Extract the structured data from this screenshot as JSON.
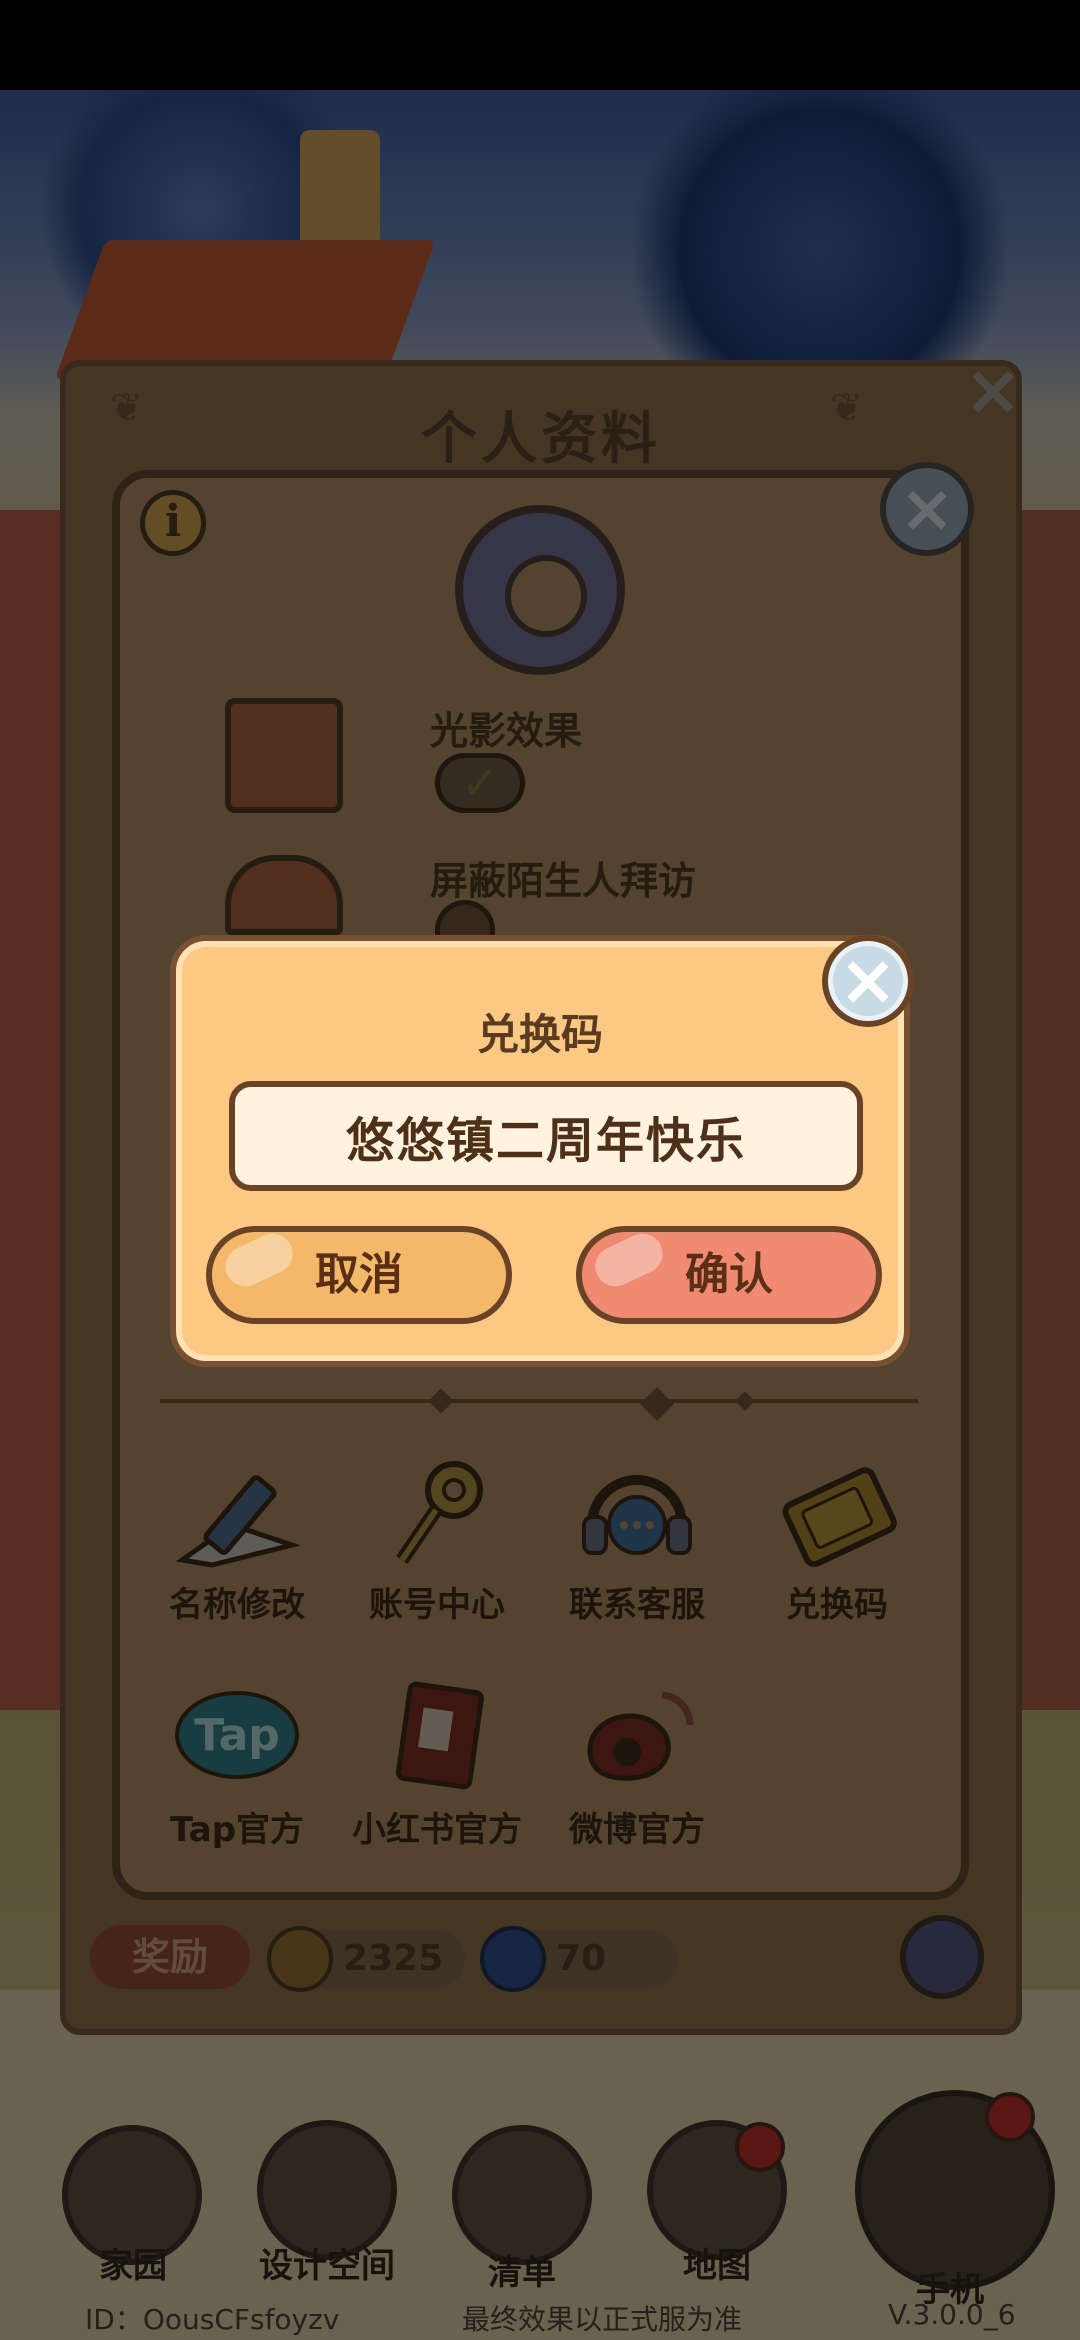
{
  "profile": {
    "title": "个人资料",
    "reward_label": "奖励",
    "coins": "2325",
    "gems": "70"
  },
  "settings": {
    "options": [
      {
        "label": "光影效果",
        "enabled": true
      },
      {
        "label": "屏蔽陌生人拜访",
        "enabled": false
      }
    ],
    "menu": [
      {
        "label": "名称修改",
        "icon": "pencil-icon"
      },
      {
        "label": "账号中心",
        "icon": "key-icon"
      },
      {
        "label": "联系客服",
        "icon": "headset-icon"
      },
      {
        "label": "兑换码",
        "icon": "ticket-icon"
      },
      {
        "label": "Tap官方",
        "icon": "tap-logo-icon"
      },
      {
        "label": "小红书官方",
        "icon": "red-book-icon"
      },
      {
        "label": "微博官方",
        "icon": "weibo-icon"
      }
    ]
  },
  "redeem_dialog": {
    "title": "兑换码",
    "code_value": "悠悠镇二周年快乐",
    "cancel_label": "取消",
    "confirm_label": "确认"
  },
  "bottom_nav": {
    "items": [
      {
        "label": "家园",
        "icon": "home-icon"
      },
      {
        "label": "设计空间",
        "icon": "design-icon"
      },
      {
        "label": "清单",
        "icon": "checklist-icon"
      },
      {
        "label": "地图",
        "icon": "map-pin-icon"
      },
      {
        "label": "手机",
        "icon": "phone-icon"
      }
    ]
  },
  "footer": {
    "player_id": "ID：OousCFsfoyzv",
    "notice": "最终效果以正式服为准",
    "version": "V.3.0.0_6"
  },
  "colors": {
    "dialog_bg": "#fcc985",
    "cancel_button": "#f3b86a",
    "confirm_button": "#f08a72",
    "panel_border": "#6a4326"
  }
}
